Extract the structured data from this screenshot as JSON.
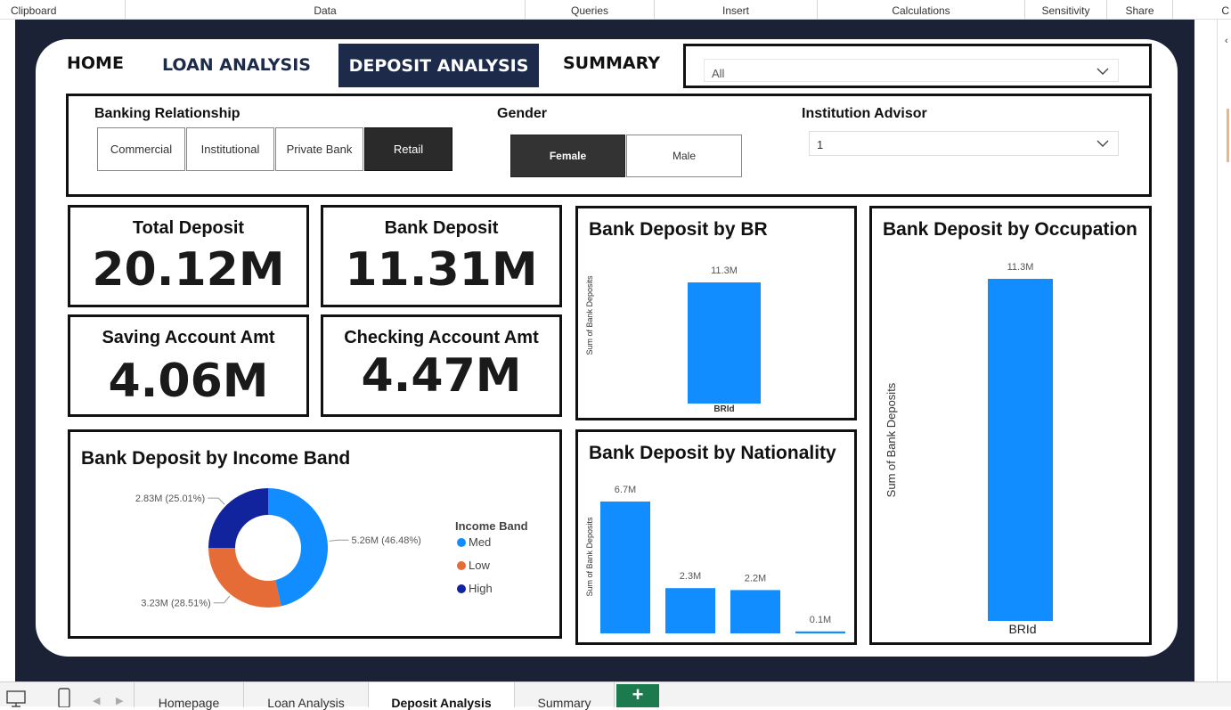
{
  "ribbon": [
    {
      "label": "Clipboard"
    },
    {
      "label": "Data"
    },
    {
      "label": "Queries"
    },
    {
      "label": "Insert"
    },
    {
      "label": "Calculations"
    },
    {
      "label": "Sensitivity"
    },
    {
      "label": "Share"
    },
    {
      "label": "C"
    }
  ],
  "nav": {
    "home": "HOME",
    "loan": "LOAN ANALYSIS",
    "deposit": "DEPOSIT ANALYSIS",
    "summary": "SUMMARY"
  },
  "top_filter": {
    "value": "All"
  },
  "slicers": {
    "banking_relationship": {
      "title": "Banking Relationship",
      "options": [
        "Commercial",
        "Institutional",
        "Private Bank",
        "Retail"
      ],
      "selected": "Retail"
    },
    "gender": {
      "title": "Gender",
      "options": [
        "Female",
        "Male"
      ],
      "selected": "Female"
    },
    "advisor": {
      "title": "Institution Advisor",
      "value": "1"
    }
  },
  "kpis": {
    "total_deposit": {
      "title": "Total Deposit",
      "value": "20.12M"
    },
    "bank_deposit": {
      "title": "Bank Deposit",
      "value": "11.31M"
    },
    "saving_account": {
      "title": "Saving Account Amt",
      "value": "4.06M"
    },
    "checking_account": {
      "title": "Checking Account Amt",
      "value": "4.47M"
    }
  },
  "charts": {
    "br": {
      "title": "Bank Deposit by BR",
      "ylabel": "Sum of Bank Deposits",
      "xlabel": "BRId"
    },
    "occupation": {
      "title": "Bank Deposit by Occupation",
      "ylabel": "Sum of Bank Deposits",
      "xlabel": "BRId"
    },
    "nationality": {
      "title": "Bank Deposit by Nationality",
      "ylabel": "Sum of Bank Deposits"
    },
    "income": {
      "title": "Bank Deposit by Income Band",
      "legend_title": "Income Band"
    }
  },
  "chart_data": [
    {
      "type": "bar",
      "title": "Bank Deposit by BR",
      "xlabel": "BRId",
      "ylabel": "Sum of Bank Deposits",
      "categories": [
        ""
      ],
      "values": [
        11.3
      ],
      "labels": [
        "11.3M"
      ],
      "ylim": [
        0,
        11.3
      ],
      "color": "#118dff"
    },
    {
      "type": "bar",
      "title": "Bank Deposit by Occupation",
      "xlabel": "BRId",
      "ylabel": "Sum of Bank Deposits",
      "categories": [
        ""
      ],
      "values": [
        11.3
      ],
      "labels": [
        "11.3M"
      ],
      "ylim": [
        0,
        11.3
      ],
      "color": "#118dff"
    },
    {
      "type": "bar",
      "title": "Bank Deposit by Nationality",
      "ylabel": "Sum of Bank Deposits",
      "categories": [
        "",
        "",
        "",
        ""
      ],
      "values": [
        6.7,
        2.3,
        2.2,
        0.1
      ],
      "labels": [
        "6.7M",
        "2.3M",
        "2.2M",
        "0.1M"
      ],
      "ylim": [
        0,
        6.7
      ],
      "color": "#118dff"
    },
    {
      "type": "pie",
      "title": "Bank Deposit by Income Band",
      "legend_title": "Income Band",
      "series": [
        {
          "name": "Med",
          "value": 5.26,
          "label": "5.26M (46.48%)",
          "color": "#118dff"
        },
        {
          "name": "Low",
          "value": 3.23,
          "label": "3.23M (28.51%)",
          "color": "#e66c37"
        },
        {
          "name": "High",
          "value": 2.83,
          "label": "2.83M (25.01%)",
          "color": "#12239e"
        }
      ]
    }
  ],
  "tabs": [
    {
      "label": "Homepage",
      "active": false
    },
    {
      "label": "Loan Analysis",
      "active": false
    },
    {
      "label": "Deposit Analysis",
      "active": true
    },
    {
      "label": "Summary",
      "active": false
    }
  ],
  "tab_add": "+"
}
